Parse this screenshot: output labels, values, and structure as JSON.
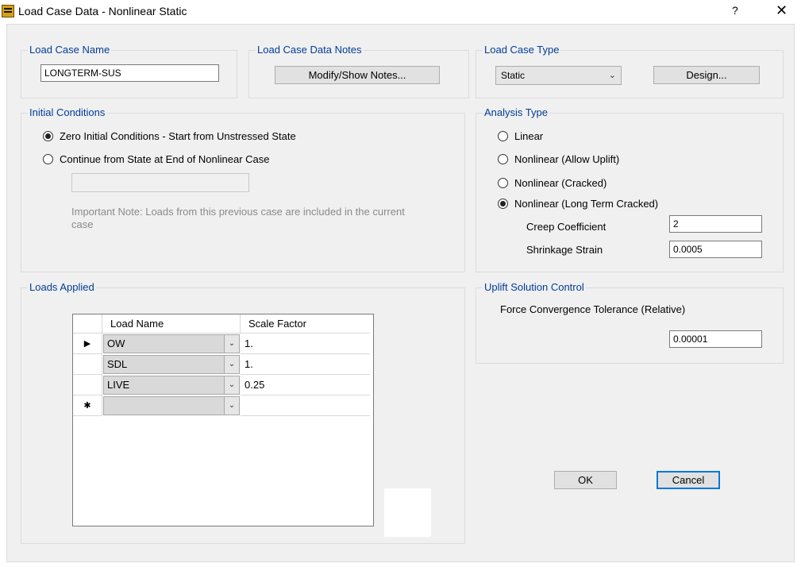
{
  "window": {
    "title": "Load Case Data - Nonlinear Static",
    "help_label": "?",
    "close_label": "✕"
  },
  "load_case_name": {
    "legend": "Load Case Name",
    "value": "LONGTERM-SUS"
  },
  "notes": {
    "legend": "Load Case Data Notes",
    "button_label": "Modify/Show Notes..."
  },
  "load_case_type": {
    "legend": "Load Case Type",
    "selected": "Static",
    "design_label": "Design..."
  },
  "initial_conditions": {
    "legend": "Initial Conditions",
    "option_zero": "Zero Initial Conditions - Start from Unstressed State",
    "option_continue": "Continue from State at End of Nonlinear Case",
    "case_value": "",
    "note": "Important Note:  Loads from this previous case are included in the current case"
  },
  "analysis_type": {
    "legend": "Analysis Type",
    "options": [
      "Linear",
      "Nonlinear (Allow Uplift)",
      "Nonlinear (Cracked)",
      "Nonlinear (Long Term Cracked)"
    ],
    "selected_index": 3,
    "creep_label": "Creep Coefficient",
    "creep_value": "2",
    "shrinkage_label": "Shrinkage Strain",
    "shrinkage_value": "0.0005"
  },
  "uplift": {
    "legend": "Uplift Solution Control",
    "tolerance_label": "Force Convergence Tolerance (Relative)",
    "tolerance_value": "0.00001"
  },
  "loads_applied": {
    "legend": "Loads Applied",
    "headers": [
      "Load Name",
      "Scale Factor"
    ],
    "rows": [
      {
        "marker": "▶",
        "name": "OW",
        "factor": "1."
      },
      {
        "marker": "",
        "name": "SDL",
        "factor": "1."
      },
      {
        "marker": "",
        "name": "LIVE",
        "factor": "0.25"
      },
      {
        "marker": "✱",
        "name": "",
        "factor": ""
      }
    ]
  },
  "buttons": {
    "ok": "OK",
    "cancel": "Cancel"
  },
  "icons": {
    "dropdown": "chevron-down-icon",
    "current_row": "row-pointer-icon",
    "new_row": "new-row-asterisk-icon"
  }
}
